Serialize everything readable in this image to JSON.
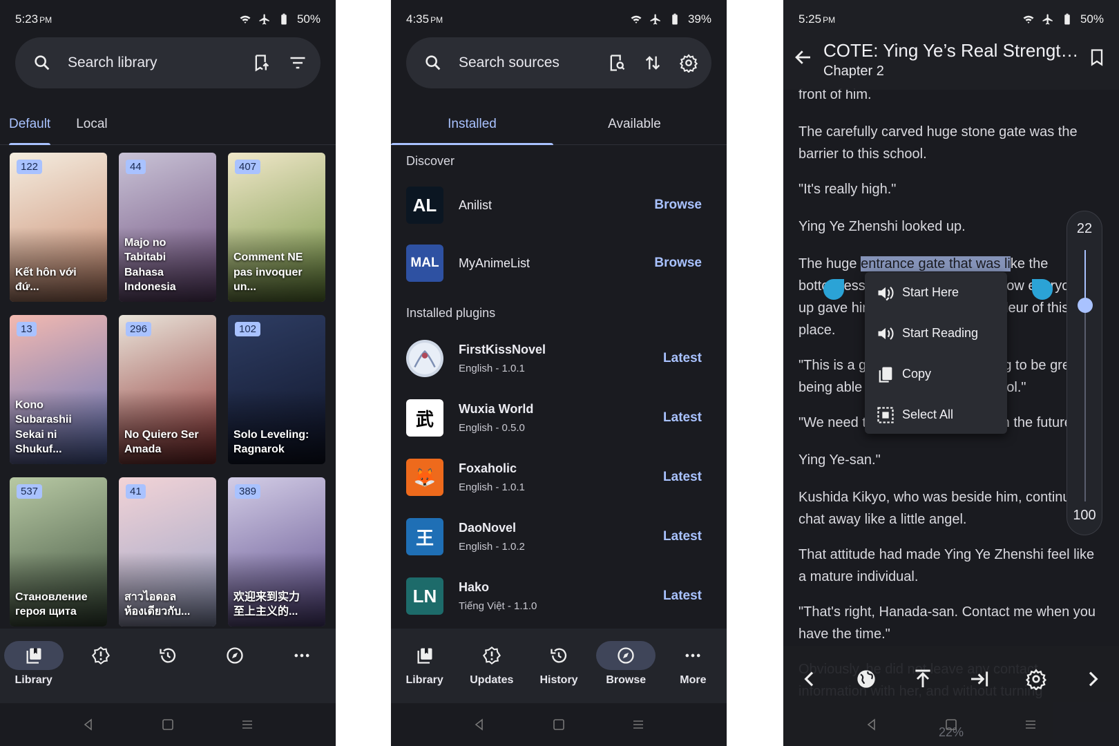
{
  "colors": {
    "accent": "#a9c2ff",
    "background": "#1a1b20",
    "surface": "#2b2d34",
    "selection_handle": "#2ba3d6"
  },
  "library": {
    "status": {
      "time": "5:23",
      "ampm": "PM",
      "battery": "50%"
    },
    "search_placeholder": "Search library",
    "tabs": [
      {
        "label": "Default",
        "active": true
      },
      {
        "label": "Local",
        "active": false
      }
    ],
    "items": [
      {
        "count": "122",
        "title": "Kết hôn với đứ...",
        "color1": "#f4ede0",
        "color2": "#c7866a"
      },
      {
        "count": "44",
        "title": "Majo no Tabitabi\nBahasa Indonesia",
        "color1": "#c9c3d6",
        "color2": "#6b4a7a"
      },
      {
        "count": "407",
        "title": "Comment NE\npas invoquer un...",
        "color1": "#f0e7c9",
        "color2": "#6e8f3e"
      },
      {
        "count": "13",
        "title": "Kono Subarashii\nSekai ni Shukuf...",
        "color1": "#f3b9b0",
        "color2": "#5a6fb8"
      },
      {
        "count": "296",
        "title": "No Quiero Ser\nAmada",
        "color1": "#e9e4da",
        "color2": "#8b2e2e"
      },
      {
        "count": "102",
        "title": "Solo Leveling:\nRagnarok",
        "color1": "#2e3d63",
        "color2": "#0f1428"
      },
      {
        "count": "537",
        "title": "Становление\nгероя щита",
        "color1": "#b8c9a4",
        "color2": "#3c4f3c"
      },
      {
        "count": "41",
        "title": "สาวไอดอล\nห้องเดียวกับ...",
        "color1": "#f2d3d6",
        "color2": "#9aa3c7"
      },
      {
        "count": "389",
        "title": "欢迎来到实力\n至上主义的...",
        "color1": "#d3cde6",
        "color2": "#5b4a8a"
      }
    ],
    "nav": [
      {
        "label": "Library",
        "icon": "library-icon",
        "active": true
      },
      {
        "label": "",
        "icon": "updates-icon",
        "active": false
      },
      {
        "label": "",
        "icon": "history-icon",
        "active": false
      },
      {
        "label": "",
        "icon": "browse-icon",
        "active": false
      },
      {
        "label": "",
        "icon": "more-icon",
        "active": false
      }
    ]
  },
  "browse": {
    "status": {
      "time": "4:35",
      "ampm": "PM",
      "battery": "39%"
    },
    "search_placeholder": "Search sources",
    "tabs": [
      {
        "label": "Installed",
        "active": true
      },
      {
        "label": "Available",
        "active": false
      }
    ],
    "discover_label": "Discover",
    "discover": [
      {
        "name": "Anilist",
        "action": "Browse",
        "logo_text": "AL",
        "logo_bg": "#0b1622",
        "logo_fg": "#ffffff"
      },
      {
        "name": "MyAnimeList",
        "action": "Browse",
        "logo_text": "MAL",
        "logo_bg": "#2e51a2",
        "logo_fg": "#ffffff"
      }
    ],
    "plugins_label": "Installed plugins",
    "plugins": [
      {
        "name": "FirstKissNovel",
        "sub": "English - 1.0.1",
        "action": "Latest",
        "logo_text": "",
        "logo_bg": "#cfd8e6",
        "logo_fg": "#6a7da0"
      },
      {
        "name": "Wuxia World",
        "sub": "English - 0.5.0",
        "action": "Latest",
        "logo_text": "武",
        "logo_bg": "#ffffff",
        "logo_fg": "#000000"
      },
      {
        "name": "Foxaholic",
        "sub": "English - 1.0.1",
        "action": "Latest",
        "logo_text": "🦊",
        "logo_bg": "#ee6a1c",
        "logo_fg": "#ffffff"
      },
      {
        "name": "DaoNovel",
        "sub": "English - 1.0.2",
        "action": "Latest",
        "logo_text": "王",
        "logo_bg": "#1f6fb5",
        "logo_fg": "#ffffff"
      },
      {
        "name": "Hako",
        "sub": "Tiếng Việt - 1.1.0",
        "action": "Latest",
        "logo_text": "LN",
        "logo_bg": "#1d6b6a",
        "logo_fg": "#ffffff"
      }
    ],
    "nav": [
      {
        "label": "Library",
        "icon": "library-icon",
        "active": false
      },
      {
        "label": "Updates",
        "icon": "updates-icon",
        "active": false
      },
      {
        "label": "History",
        "icon": "history-icon",
        "active": false
      },
      {
        "label": "Browse",
        "icon": "browse-icon",
        "active": true
      },
      {
        "label": "More",
        "icon": "more-icon",
        "active": false
      }
    ]
  },
  "reader": {
    "status": {
      "time": "5:25",
      "ampm": "PM",
      "battery": "50%"
    },
    "title": "COTE: Ying Ye’s Real Strength...",
    "chapter": "Chapter 2",
    "paragraphs": [
      {
        "text": "front of him."
      },
      {
        "text": "The carefully carved huge stone gate was the barrier to this school."
      },
      {
        "text": "\"It's really high.\""
      },
      {
        "text": "Ying Ye Zhenshi looked up."
      },
      {
        "text_before": "The huge ",
        "text_selected": "entrance gate that was li",
        "text_after": "ke the bottomless abyss that would swallow everyone up gave him a sense for the grandeur of this place."
      },
      {
        "text": "\"This is a great academy. It's going to be great being able to study in such a school.\""
      },
      {
        "text": "\"We need to keep in touch more in the future,"
      },
      {
        "text": "Ying Ye-san.\""
      },
      {
        "text": "Kushida Kikyo, who was beside him, continued to chat away like a little angel."
      },
      {
        "text": "That attitude had made Ying Ye Zhenshi feel like a mature individual."
      },
      {
        "text": "\"That's right, Hanada-san. Contact me when you have the time.\""
      },
      {
        "text": "Obviously, he did not leave any contact information with her, and without turning"
      }
    ],
    "popup": [
      {
        "label": "Start Here",
        "icon": "tts-here-icon"
      },
      {
        "label": "Start Reading",
        "icon": "tts-icon"
      },
      {
        "label": "Copy",
        "icon": "copy-icon"
      },
      {
        "label": "Select All",
        "icon": "select-all-icon"
      }
    ],
    "slider": {
      "top": "22",
      "bottom": "100",
      "value_fraction": 0.22
    },
    "progress": "22%"
  }
}
